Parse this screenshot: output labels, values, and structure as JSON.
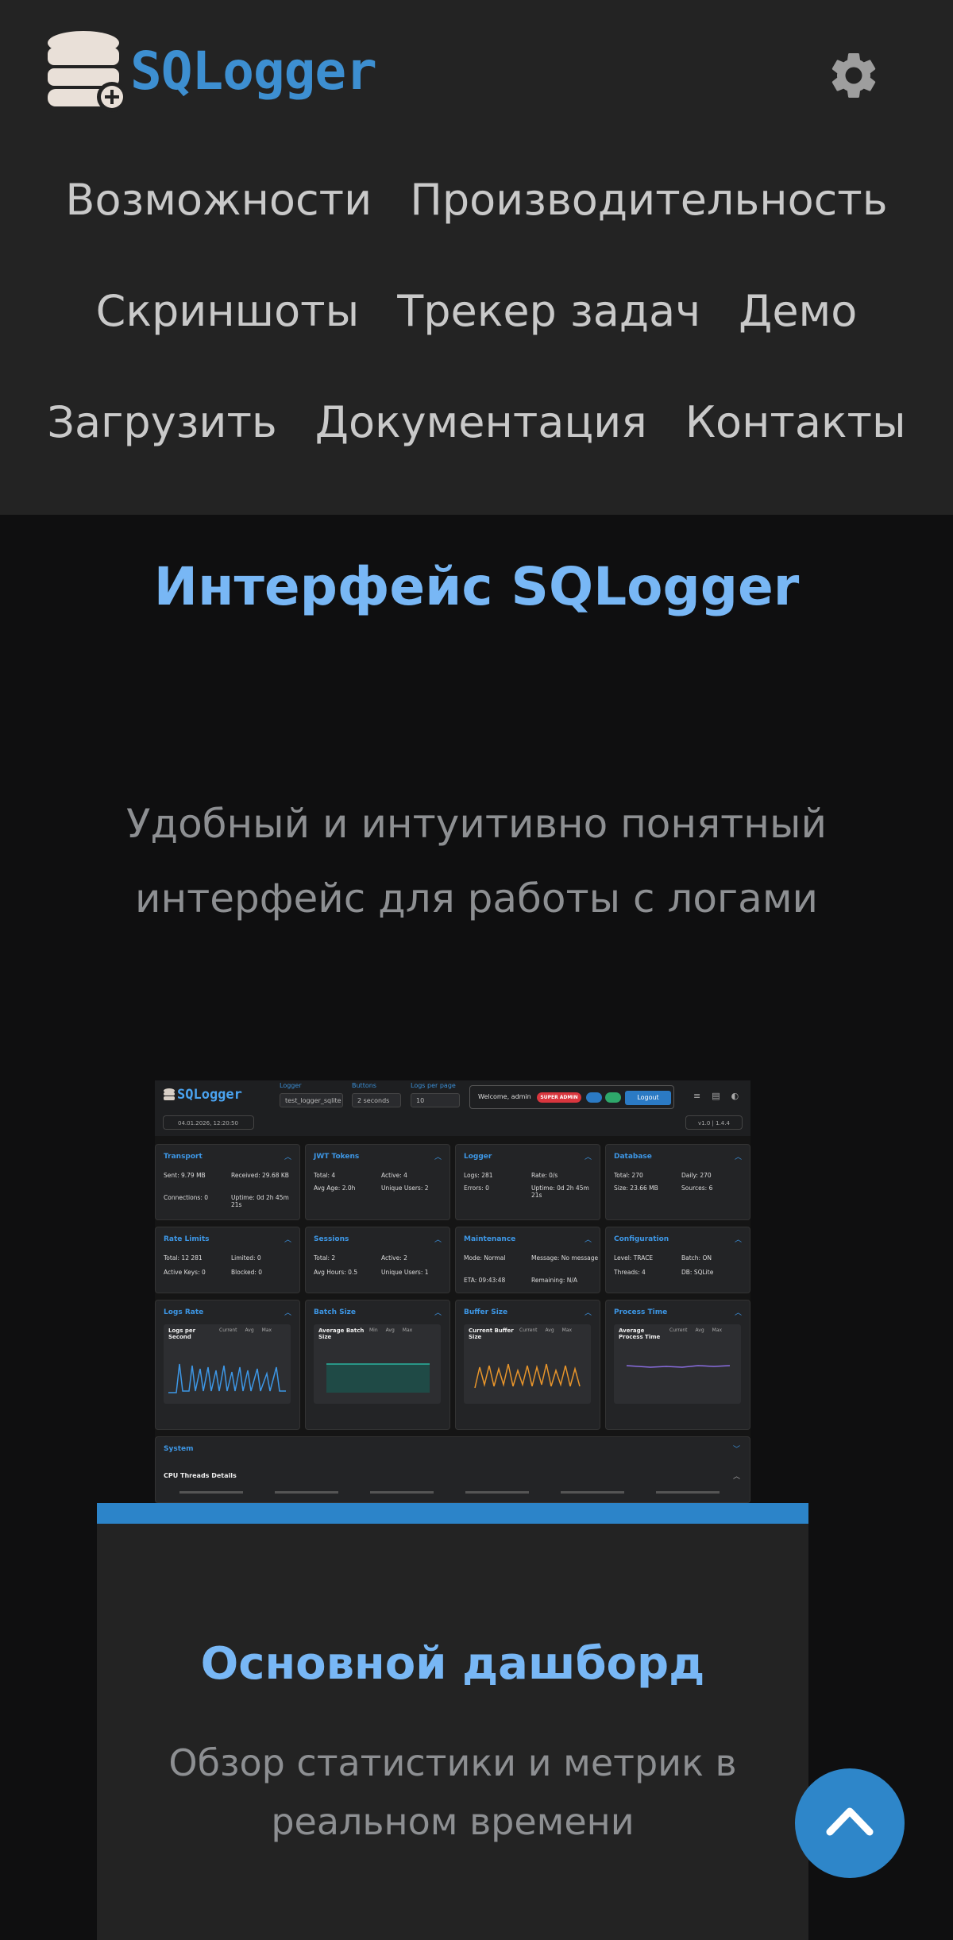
{
  "header": {
    "logo_text": "SQLogger",
    "nav": [
      [
        "Возможности",
        "Производительность"
      ],
      [
        "Скриншоты",
        "Трекер задач",
        "Демо"
      ],
      [
        "Загрузить",
        "Документация",
        "Контакты"
      ]
    ]
  },
  "section": {
    "title": "Интерфейс SQLogger",
    "subtitle": "Удобный и интуитивно понятный интерфейс для работы с логами"
  },
  "screenshot": {
    "logo": "SQLogger",
    "logger_label": "Logger",
    "logger_value": "test_logger_sqlite",
    "buttons_label": "Buttons",
    "buttons_value": "2 seconds",
    "logs_label": "Logs per page",
    "logs_value": "10",
    "welcome": "Welcome, admin",
    "badge": "SUPER ADMIN",
    "logout": "Logout",
    "date": "04.01.2026, 12:20:50",
    "version": "v1.0 | 1.4.4",
    "cards": [
      {
        "title": "Transport",
        "rows": [
          [
            "Sent: 9.79 MB",
            "Received: 29.68 KB"
          ],
          [
            "Connections: 0",
            "Uptime: 0d 2h 45m 21s"
          ]
        ]
      },
      {
        "title": "JWT Tokens",
        "rows": [
          [
            "Total: 4",
            "Active: 4"
          ],
          [
            "Avg Age: 2.0h",
            "Unique Users: 2"
          ]
        ]
      },
      {
        "title": "Logger",
        "rows": [
          [
            "Logs: 281",
            "Rate: 0/s"
          ],
          [
            "Errors: 0",
            "Uptime: 0d 2h 45m 21s"
          ]
        ]
      },
      {
        "title": "Database",
        "rows": [
          [
            "Total: 270",
            "Daily: 270"
          ],
          [
            "Size: 23.66 MB",
            "Sources: 6"
          ]
        ]
      },
      {
        "title": "Rate Limits",
        "rows": [
          [
            "Total: 12 281",
            "Limited: 0"
          ],
          [
            "Active Keys: 0",
            "Blocked: 0"
          ]
        ]
      },
      {
        "title": "Sessions",
        "rows": [
          [
            "Total: 2",
            "Active: 2"
          ],
          [
            "Avg Hours: 0.5",
            "Unique Users: 1"
          ]
        ]
      },
      {
        "title": "Maintenance",
        "rows": [
          [
            "Mode: Normal",
            "Message: No message"
          ],
          [
            "ETA: 09:43:48",
            "Remaining: N/A"
          ]
        ]
      },
      {
        "title": "Configuration",
        "rows": [
          [
            "Level: TRACE",
            "Batch: ON"
          ],
          [
            "Threads: 4",
            "DB: SQLite"
          ]
        ]
      }
    ],
    "charts": [
      {
        "title": "Logs Rate",
        "head": "Logs per Second",
        "cols": [
          "Current",
          "Avg",
          "Max"
        ],
        "color": "#3d97e6"
      },
      {
        "title": "Batch Size",
        "head": "Average Batch Size",
        "cols": [
          "Min",
          "Avg",
          "Max"
        ],
        "color": "#2bb3a0"
      },
      {
        "title": "Buffer Size",
        "head": "Current Buffer Size",
        "cols": [
          "Current",
          "Avg",
          "Max"
        ],
        "color": "#e8952b"
      },
      {
        "title": "Process Time",
        "head": "Average Process Time",
        "cols": [
          "Current",
          "Avg",
          "Max"
        ],
        "color": "#8a6de0"
      }
    ],
    "system_title": "System",
    "threads_title": "CPU Threads Details"
  },
  "caption": {
    "title": "Основной дашборд",
    "desc": "Обзор статистики и метрик в реальном времени"
  },
  "colors": {
    "accent": "#2e86c9",
    "title_blue": "#78b7f5",
    "header_bg": "#232323"
  }
}
